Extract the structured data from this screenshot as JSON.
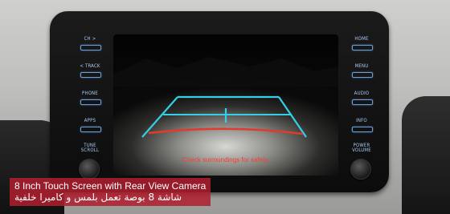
{
  "left_buttons": [
    "CH >",
    "< TRACK",
    "PHONE",
    "APPS",
    "TUNE\nSCROLL"
  ],
  "right_buttons": [
    "HOME",
    "MENU",
    "AUDIO",
    "INFO",
    "POWER\nVOLUME"
  ],
  "screen": {
    "warning_text": "Check surroundings for safety."
  },
  "caption": {
    "english": "8 Inch Touch Screen with Rear View Camera",
    "arabic": "شاشة 8 بوصة تعمل بلمس و كاميرا خلفية"
  },
  "colors": {
    "guide_line": "#33d0e8",
    "stop_line": "#e23a2e",
    "button_glow": "#6a9fd8",
    "caption_bg": "#af1e2d"
  },
  "icons": [
    "tune-scroll-knob",
    "power-volume-knob"
  ]
}
